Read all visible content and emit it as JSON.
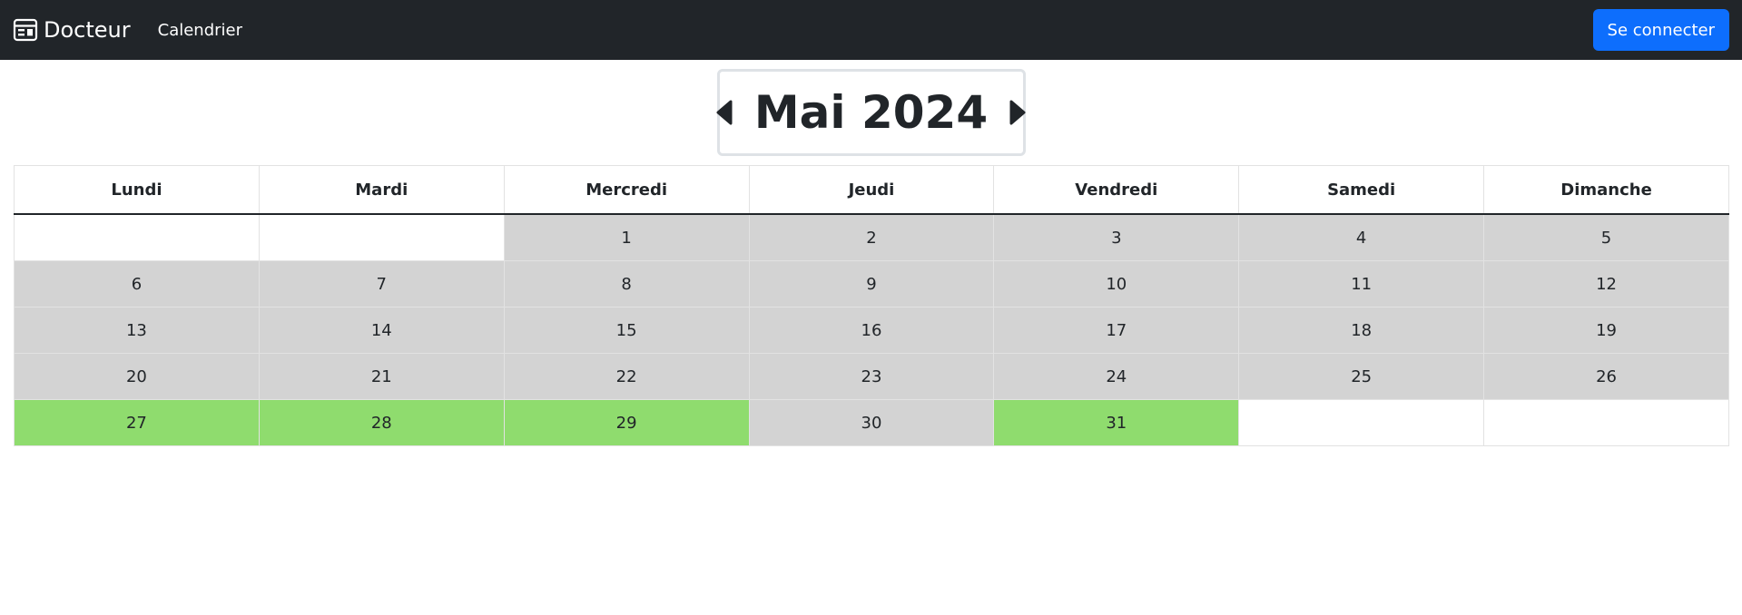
{
  "navbar": {
    "brand": "Docteur",
    "brand_icon": "calendar-card-icon",
    "links": [
      "Calendrier"
    ],
    "login_label": "Se connecter",
    "bg_color": "#212529",
    "login_color": "#0d6efd"
  },
  "calendar": {
    "month_label": "Mai 2024",
    "prev_icon": "caret-left-icon",
    "next_icon": "caret-right-icon",
    "weekdays": [
      "Lundi",
      "Mardi",
      "Mercredi",
      "Jeudi",
      "Vendredi",
      "Samedi",
      "Dimanche"
    ],
    "colors": {
      "unavailable": "#d3d3d3",
      "available": "#8fdc6e",
      "empty": "#ffffff"
    },
    "weeks": [
      [
        {
          "day": "",
          "status": "empty"
        },
        {
          "day": "",
          "status": "empty"
        },
        {
          "day": "1",
          "status": "unavailable"
        },
        {
          "day": "2",
          "status": "unavailable"
        },
        {
          "day": "3",
          "status": "unavailable"
        },
        {
          "day": "4",
          "status": "unavailable"
        },
        {
          "day": "5",
          "status": "unavailable"
        }
      ],
      [
        {
          "day": "6",
          "status": "unavailable"
        },
        {
          "day": "7",
          "status": "unavailable"
        },
        {
          "day": "8",
          "status": "unavailable"
        },
        {
          "day": "9",
          "status": "unavailable"
        },
        {
          "day": "10",
          "status": "unavailable"
        },
        {
          "day": "11",
          "status": "unavailable"
        },
        {
          "day": "12",
          "status": "unavailable"
        }
      ],
      [
        {
          "day": "13",
          "status": "unavailable"
        },
        {
          "day": "14",
          "status": "unavailable"
        },
        {
          "day": "15",
          "status": "unavailable"
        },
        {
          "day": "16",
          "status": "unavailable"
        },
        {
          "day": "17",
          "status": "unavailable"
        },
        {
          "day": "18",
          "status": "unavailable"
        },
        {
          "day": "19",
          "status": "unavailable"
        }
      ],
      [
        {
          "day": "20",
          "status": "unavailable"
        },
        {
          "day": "21",
          "status": "unavailable"
        },
        {
          "day": "22",
          "status": "unavailable"
        },
        {
          "day": "23",
          "status": "unavailable"
        },
        {
          "day": "24",
          "status": "unavailable"
        },
        {
          "day": "25",
          "status": "unavailable"
        },
        {
          "day": "26",
          "status": "unavailable"
        }
      ],
      [
        {
          "day": "27",
          "status": "available"
        },
        {
          "day": "28",
          "status": "available"
        },
        {
          "day": "29",
          "status": "available"
        },
        {
          "day": "30",
          "status": "unavailable"
        },
        {
          "day": "31",
          "status": "available"
        },
        {
          "day": "",
          "status": "empty"
        },
        {
          "day": "",
          "status": "empty"
        }
      ]
    ]
  }
}
